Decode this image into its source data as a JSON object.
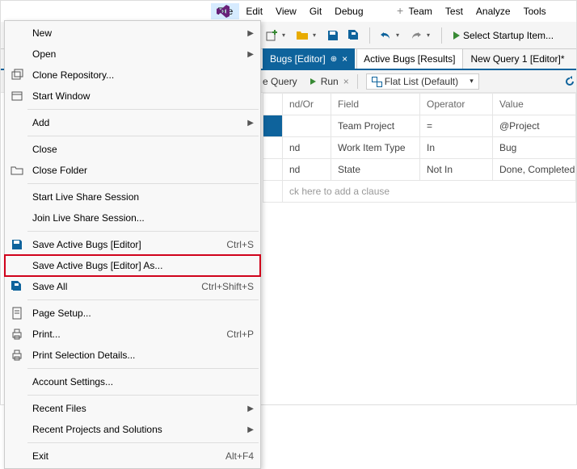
{
  "menubar": {
    "items": [
      "File",
      "Edit",
      "View",
      "Git",
      "Debug",
      "Team",
      "Test",
      "Analyze",
      "Tools"
    ]
  },
  "toolbar": {
    "startup_label": "Select Startup Item..."
  },
  "tabs": [
    {
      "label": "Bugs [Editor]",
      "active": true,
      "pinned": true
    },
    {
      "label": "Active Bugs [Results]",
      "active": false
    },
    {
      "label": "New Query 1 [Editor]*",
      "active": false,
      "plain": true
    }
  ],
  "querybar": {
    "query_label": "e Query",
    "run_label": "Run",
    "flatlist_label": "Flat List (Default)"
  },
  "grid": {
    "headers": [
      "",
      "nd/Or",
      "Field",
      "Operator",
      "Value"
    ],
    "rows": [
      {
        "sel": true,
        "andor": "",
        "field": "Team Project",
        "op": "=",
        "val": "@Project"
      },
      {
        "sel": false,
        "andor": "nd",
        "field": "Work Item Type",
        "op": "In",
        "val": "Bug"
      },
      {
        "sel": false,
        "andor": "nd",
        "field": "State",
        "op": "Not In",
        "val": "Done, Completed,"
      }
    ],
    "addrow_label": "ck here to add a clause"
  },
  "filemenu": [
    {
      "type": "item",
      "label": "New",
      "submenu": true
    },
    {
      "type": "item",
      "label": "Open",
      "submenu": true
    },
    {
      "type": "item",
      "icon": "clone",
      "label": "Clone Repository..."
    },
    {
      "type": "item",
      "icon": "window",
      "label": "Start Window"
    },
    {
      "type": "sep"
    },
    {
      "type": "item",
      "label": "Add",
      "submenu": true
    },
    {
      "type": "sep"
    },
    {
      "type": "item",
      "label": "Close"
    },
    {
      "type": "item",
      "icon": "closefolder",
      "label": "Close Folder"
    },
    {
      "type": "sep"
    },
    {
      "type": "item",
      "label": "Start Live Share Session"
    },
    {
      "type": "item",
      "label": "Join Live Share Session..."
    },
    {
      "type": "sep"
    },
    {
      "type": "item",
      "icon": "save",
      "label": "Save Active Bugs [Editor]",
      "shortcut": "Ctrl+S"
    },
    {
      "type": "item",
      "label": "Save Active Bugs [Editor] As...",
      "highlight": true
    },
    {
      "type": "item",
      "icon": "saveall",
      "label": "Save All",
      "shortcut": "Ctrl+Shift+S"
    },
    {
      "type": "sep"
    },
    {
      "type": "item",
      "icon": "pagesetup",
      "label": "Page Setup..."
    },
    {
      "type": "item",
      "icon": "print",
      "label": "Print...",
      "shortcut": "Ctrl+P"
    },
    {
      "type": "item",
      "icon": "print",
      "label": "Print Selection Details..."
    },
    {
      "type": "sep"
    },
    {
      "type": "item",
      "label": "Account Settings..."
    },
    {
      "type": "sep"
    },
    {
      "type": "item",
      "label": "Recent Files",
      "submenu": true
    },
    {
      "type": "item",
      "label": "Recent Projects and Solutions",
      "submenu": true
    },
    {
      "type": "sep"
    },
    {
      "type": "item",
      "label": "Exit",
      "shortcut": "Alt+F4"
    }
  ]
}
